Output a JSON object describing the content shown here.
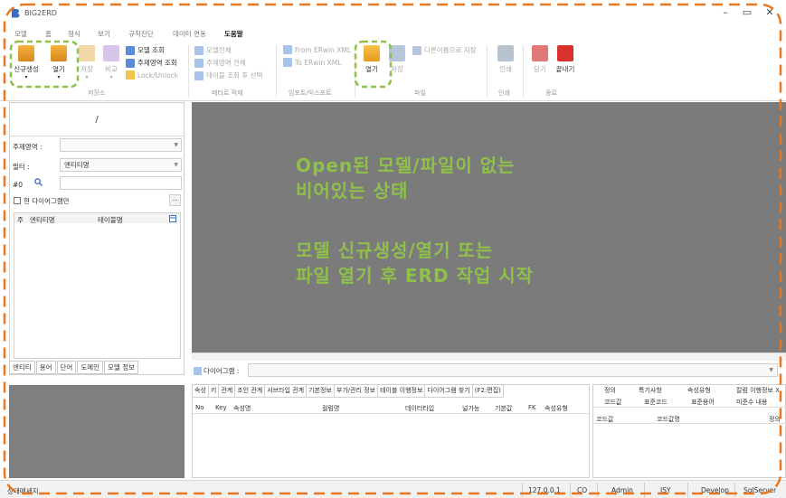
{
  "window": {
    "title": "BIG2ERD",
    "minimize_glyph": "–",
    "restore_glyph": "▭",
    "close_glyph": "✕"
  },
  "menu": [
    {
      "label": "모델",
      "active": false
    },
    {
      "label": "홈",
      "active": false
    },
    {
      "label": "형식",
      "active": false
    },
    {
      "label": "보기",
      "active": false
    },
    {
      "label": "규칙진단",
      "active": false
    },
    {
      "label": "데이터 연동",
      "active": false
    },
    {
      "label": "도움말",
      "active": true
    }
  ],
  "ribbon": {
    "new_model": "신규생성",
    "open": "열기",
    "save": "저장",
    "compare": "비교",
    "model_query": "모델 조회",
    "subject_area_query": "주제영역 조회",
    "lock_unlock": "Lock/Unlock",
    "group_save": "저장소",
    "model_all": "모델전체",
    "subject_area_all": "주제영역 전체",
    "table_select": "테이블 조회 후 선택",
    "group_meta": "메타로 적재",
    "from_erwin": "From ERwin XML",
    "to_erwin": "To ERwin XML",
    "group_import_export": "임포트/익스포트",
    "file_open": "열기",
    "file_save": "저장",
    "save_as": "다른이름으로 저장",
    "group_file": "파일",
    "print": "인쇄",
    "group_print": "인쇄",
    "close": "닫기",
    "exit": "끝내기",
    "group_exit": "종료"
  },
  "left_panel": {
    "title": "/",
    "subject_area_label": "주제영역 :",
    "subject_area_value": "",
    "filter_label": "필터 :",
    "filter_value": "엔티티명",
    "count_label": "#0",
    "current_diagram_only": "현 다이어그램만",
    "ellipsis": "...",
    "col_sort": "주",
    "col_entity": "엔티티명",
    "col_table": "테이블명",
    "tabs": [
      "엔티티",
      "용어",
      "단어",
      "도메인",
      "모델 정보"
    ]
  },
  "canvas": {
    "line1": "Open된 모델/파일이 없는",
    "line2": "비어있는 상태",
    "line3": "모델 신규생성/열기 또는",
    "line4": "파일 열기 후 ERD 작업 시작",
    "text_color": "#8ec04a",
    "bg_color": "#7b7b7b"
  },
  "diagram_bar": {
    "label": "다이어그램 :",
    "value": ""
  },
  "detail_tabs": [
    "속성",
    "키",
    "관계",
    "조인 관계",
    "서브타입 관계",
    "기본정보",
    "부가/관리 정보",
    "테이블 이행정보",
    "다이어그램 찾기",
    "(F2:편집)"
  ],
  "detail_columns": [
    "No",
    "Key",
    "속성명",
    "컬럼명",
    "데이터타입",
    "널가능",
    "기본값",
    "FK",
    "속성유형"
  ],
  "right_tabs_row1": [
    "정의",
    "특기사항",
    "속성유형",
    "칼럼 이행정보 X"
  ],
  "right_tabs_row2": [
    "코드값",
    "표준코드",
    "표준용어",
    "미준수 내용"
  ],
  "right_columns": [
    "코드값",
    "코드값명",
    "정의"
  ],
  "status": {
    "message": "상태메세지",
    "ip": "127.0.0.1",
    "co": "CO",
    "user": "Admin",
    "user2": "JSY",
    "env": "Develop",
    "db": "SqlServer"
  },
  "annotation": {
    "color": "#e87722",
    "highlight_color": "#8ec04a"
  }
}
